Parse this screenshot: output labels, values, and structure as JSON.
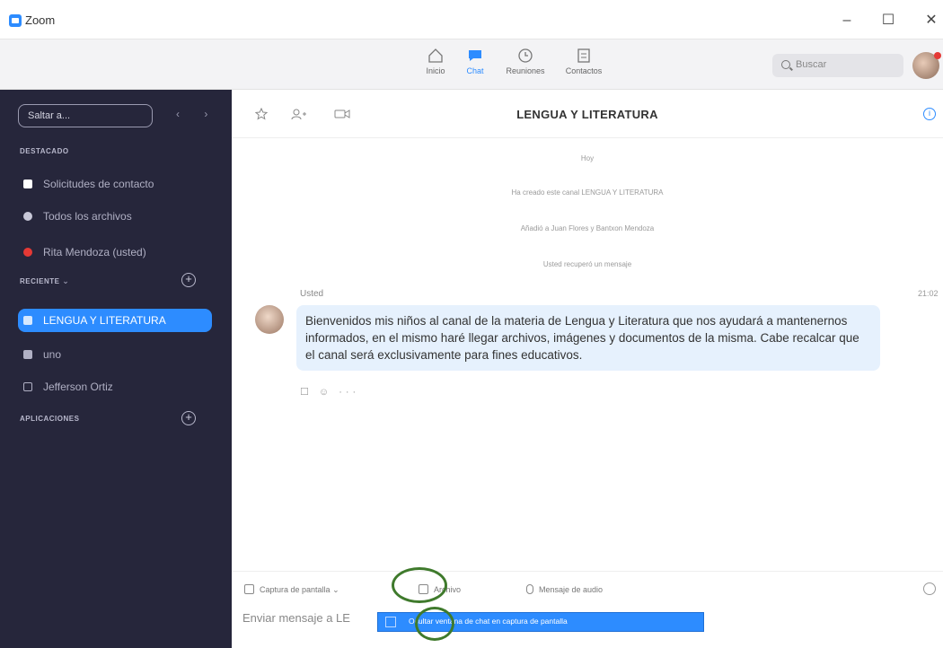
{
  "window": {
    "title": "Zoom",
    "min_label": "–",
    "max_label": "☐",
    "close_label": "✕"
  },
  "nav": {
    "tabs": [
      {
        "label": "Inicio"
      },
      {
        "label": "Chat"
      },
      {
        "label": "Reuniones"
      },
      {
        "label": "Contactos"
      }
    ],
    "active_tab": "Chat",
    "search_placeholder": "Buscar"
  },
  "sidebar": {
    "jump_placeholder": "Saltar a...",
    "arrows": "‹ ›",
    "starred_title": "DESTACADO",
    "starred_items": [
      {
        "label": "Solicitudes de contacto",
        "icon": "contact-request-icon",
        "color": "#ffffff"
      },
      {
        "label": "Todos los archivos",
        "icon": "files-icon",
        "color": "#c8c8d8"
      },
      {
        "label": "Rita Mendoza (usted)",
        "icon": "user-icon",
        "color": "#e53935"
      }
    ],
    "recent_title": "RECIENTE",
    "recent_items": [
      {
        "label": "LENGUA Y LITERATURA",
        "icon": "channel-icon",
        "active": true
      },
      {
        "label": "uno",
        "icon": "channel-icon",
        "active": false
      },
      {
        "label": "Jefferson Ortiz",
        "icon": "user-icon",
        "active": false
      }
    ],
    "apps_title": "APLICACIONES",
    "plus": "+"
  },
  "chat": {
    "channel_title": "LENGUA Y LITERATURA",
    "header_icons": [
      "star-icon",
      "add-member-icon",
      "video-icon"
    ],
    "info": "i",
    "system_messages": [
      "Hoy",
      "Ha creado este canal LENGUA Y LITERATURA",
      "Añadió a Juan Flores y Bantxon Mendoza",
      "Usted recuperó un mensaje"
    ],
    "message": {
      "sender": "Usted",
      "time": "21:02",
      "text": "Bienvenidos mis niños al canal de la materia de Lengua y Literatura que nos ayudará a mantenernos informados, en el mismo haré llegar archivos, imágenes y documentos de la misma. Cabe recalcar que el canal será exclusivamente para fines educativos.",
      "actions": "☐ ☺ ···"
    }
  },
  "composer": {
    "capture_label": "Captura de pantalla",
    "capture_caret": "⌄",
    "files_label": "Archivo",
    "audio_label": "Mensaje de audio",
    "input_placeholder": "Enviar mensaje a LE",
    "dropdown_option": "Ocultar ventana de chat en captura de pantalla"
  },
  "colors": {
    "accent": "#2d8cff",
    "sidebar_bg": "#26263b",
    "bubble_bg": "#e6f1fd",
    "highlight": "#3f7a2c"
  }
}
